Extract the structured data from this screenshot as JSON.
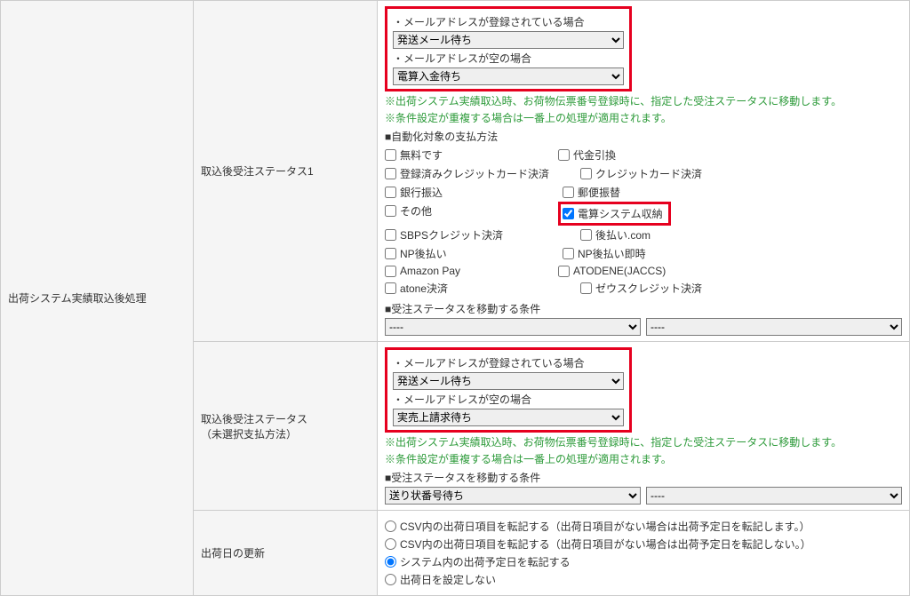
{
  "side": {
    "title": "出荷システム実績取込後処理"
  },
  "block1": {
    "rowLabel": "取込後受注ステータス1",
    "emailRegistered": "・メールアドレスが登録されている場合",
    "emailRegisteredSelect": "発送メール待ち",
    "emailEmpty": "・メールアドレスが空の場合",
    "emailEmptySelect": "電算入金待ち",
    "note1": "※出荷システム実績取込時、お荷物伝票番号登録時に、指定した受注ステータスに移動します。",
    "note2": "※条件設定が重複する場合は一番上の処理が適用されます。",
    "pmHeader": "■自動化対象の支払方法",
    "pm": {
      "free": "無料です",
      "cod": "代金引換",
      "regcc": "登録済みクレジットカード決済",
      "cc": "クレジットカード決済",
      "bank": "銀行振込",
      "postal": "郵便振替",
      "other": "その他",
      "densan": "電算システム収納",
      "sbps": "SBPSクレジット決済",
      "atobarai": "後払い.com",
      "npato": "NP後払い",
      "npsoku": "NP後払い即時",
      "amazon": "Amazon Pay",
      "atodene": "ATODENE(JACCS)",
      "atone": "atone決済",
      "zeus": "ゼウスクレジット決済"
    },
    "condHeader": "■受注ステータスを移動する条件",
    "condLeft": "----",
    "condRight": "----"
  },
  "block2": {
    "rowLabel1": "取込後受注ステータス",
    "rowLabel2": "（未選択支払方法）",
    "emailRegistered": "・メールアドレスが登録されている場合",
    "emailRegisteredSelect": "発送メール待ち",
    "emailEmpty": "・メールアドレスが空の場合",
    "emailEmptySelect": "実売上請求待ち",
    "note1": "※出荷システム実績取込時、お荷物伝票番号登録時に、指定した受注ステータスに移動します。",
    "note2": "※条件設定が重複する場合は一番上の処理が適用されます。",
    "condHeader": "■受注ステータスを移動する条件",
    "condLeft": "送り状番号待ち",
    "condRight": "----"
  },
  "block3": {
    "rowLabel": "出荷日の更新",
    "r1": "CSV内の出荷日項目を転記する（出荷日項目がない場合は出荷予定日を転記します。）",
    "r2": "CSV内の出荷日項目を転記する（出荷日項目がない場合は出荷予定日を転記しない。）",
    "r3": "システム内の出荷予定日を転記する",
    "r4": "出荷日を設定しない"
  }
}
